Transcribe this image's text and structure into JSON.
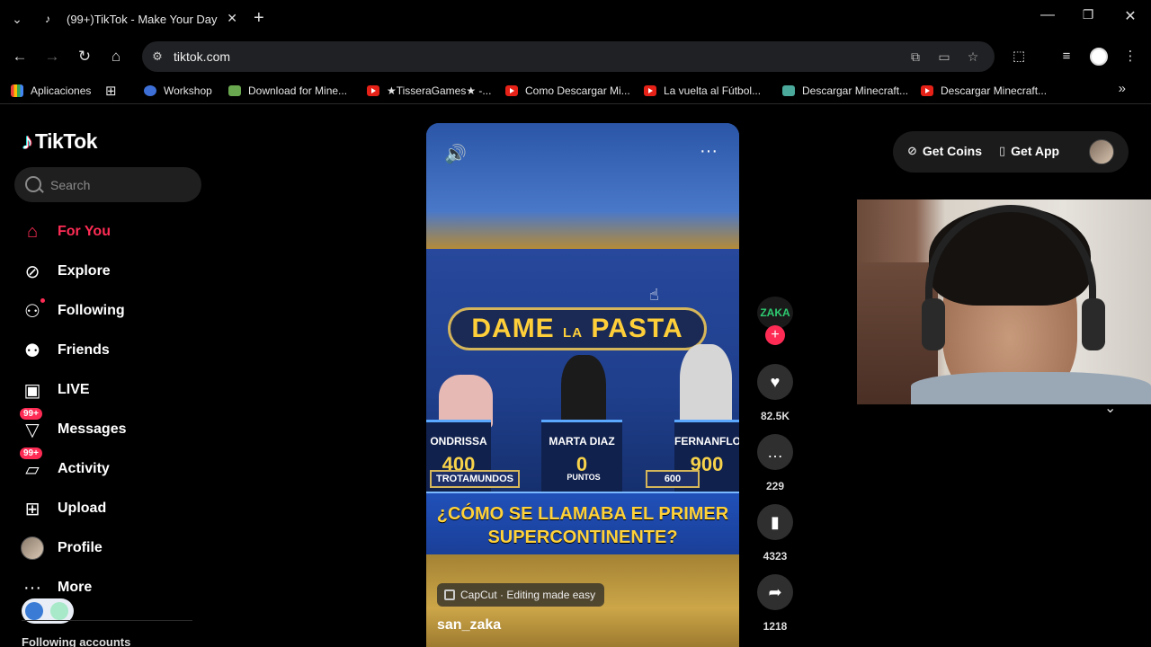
{
  "browser": {
    "tab_title": "(99+)TikTok - Make Your Day",
    "url": "tiktok.com",
    "bookmarks": [
      "Aplicaciones",
      "Workshop",
      "Download for Mine...",
      "★TisseraGames★ -...",
      "Como Descargar Mi...",
      "La vuelta al Fútbol...",
      "Descargar Minecraft...",
      "Descargar Minecraft..."
    ]
  },
  "tiktok": {
    "logo": "TikTok",
    "search_placeholder": "Search",
    "nav": [
      {
        "label": "For You",
        "icon": "home-icon"
      },
      {
        "label": "Explore",
        "icon": "compass-icon"
      },
      {
        "label": "Following",
        "icon": "following-icon"
      },
      {
        "label": "Friends",
        "icon": "friends-icon"
      },
      {
        "label": "LIVE",
        "icon": "live-icon"
      },
      {
        "label": "Messages",
        "icon": "messages-icon",
        "badge": "99+"
      },
      {
        "label": "Activity",
        "icon": "activity-icon",
        "badge": "99+"
      },
      {
        "label": "Upload",
        "icon": "upload-icon"
      },
      {
        "label": "Profile",
        "icon": "avatar"
      },
      {
        "label": "More",
        "icon": "more-icon"
      }
    ],
    "following_accounts": "Following accounts",
    "get_coins": "Get Coins",
    "get_app": "Get App",
    "accent": "#fe2c55"
  },
  "video": {
    "show_title": "DAME",
    "show_title_mid": "LA",
    "show_title_end": "PASTA",
    "contestants": [
      {
        "name": "ONDRISSA",
        "score": "400",
        "team": "TROTAMUNDOS"
      },
      {
        "name": "MARTA DIAZ",
        "score": "0",
        "team": "PUNTOS"
      },
      {
        "name": "FERNANFLO",
        "score": "900",
        "team": "600"
      }
    ],
    "question_line1": "¿CÓMO SE LLAMABA EL PRIMER",
    "question_line2": "SUPERCONTINENTE?",
    "capcut": "CapCut · Editing made easy",
    "author": "san_zaka",
    "creator_avatar_text": "ZAKA",
    "likes": "82.5K",
    "comments": "229",
    "saves": "4323",
    "shares": "1218"
  }
}
